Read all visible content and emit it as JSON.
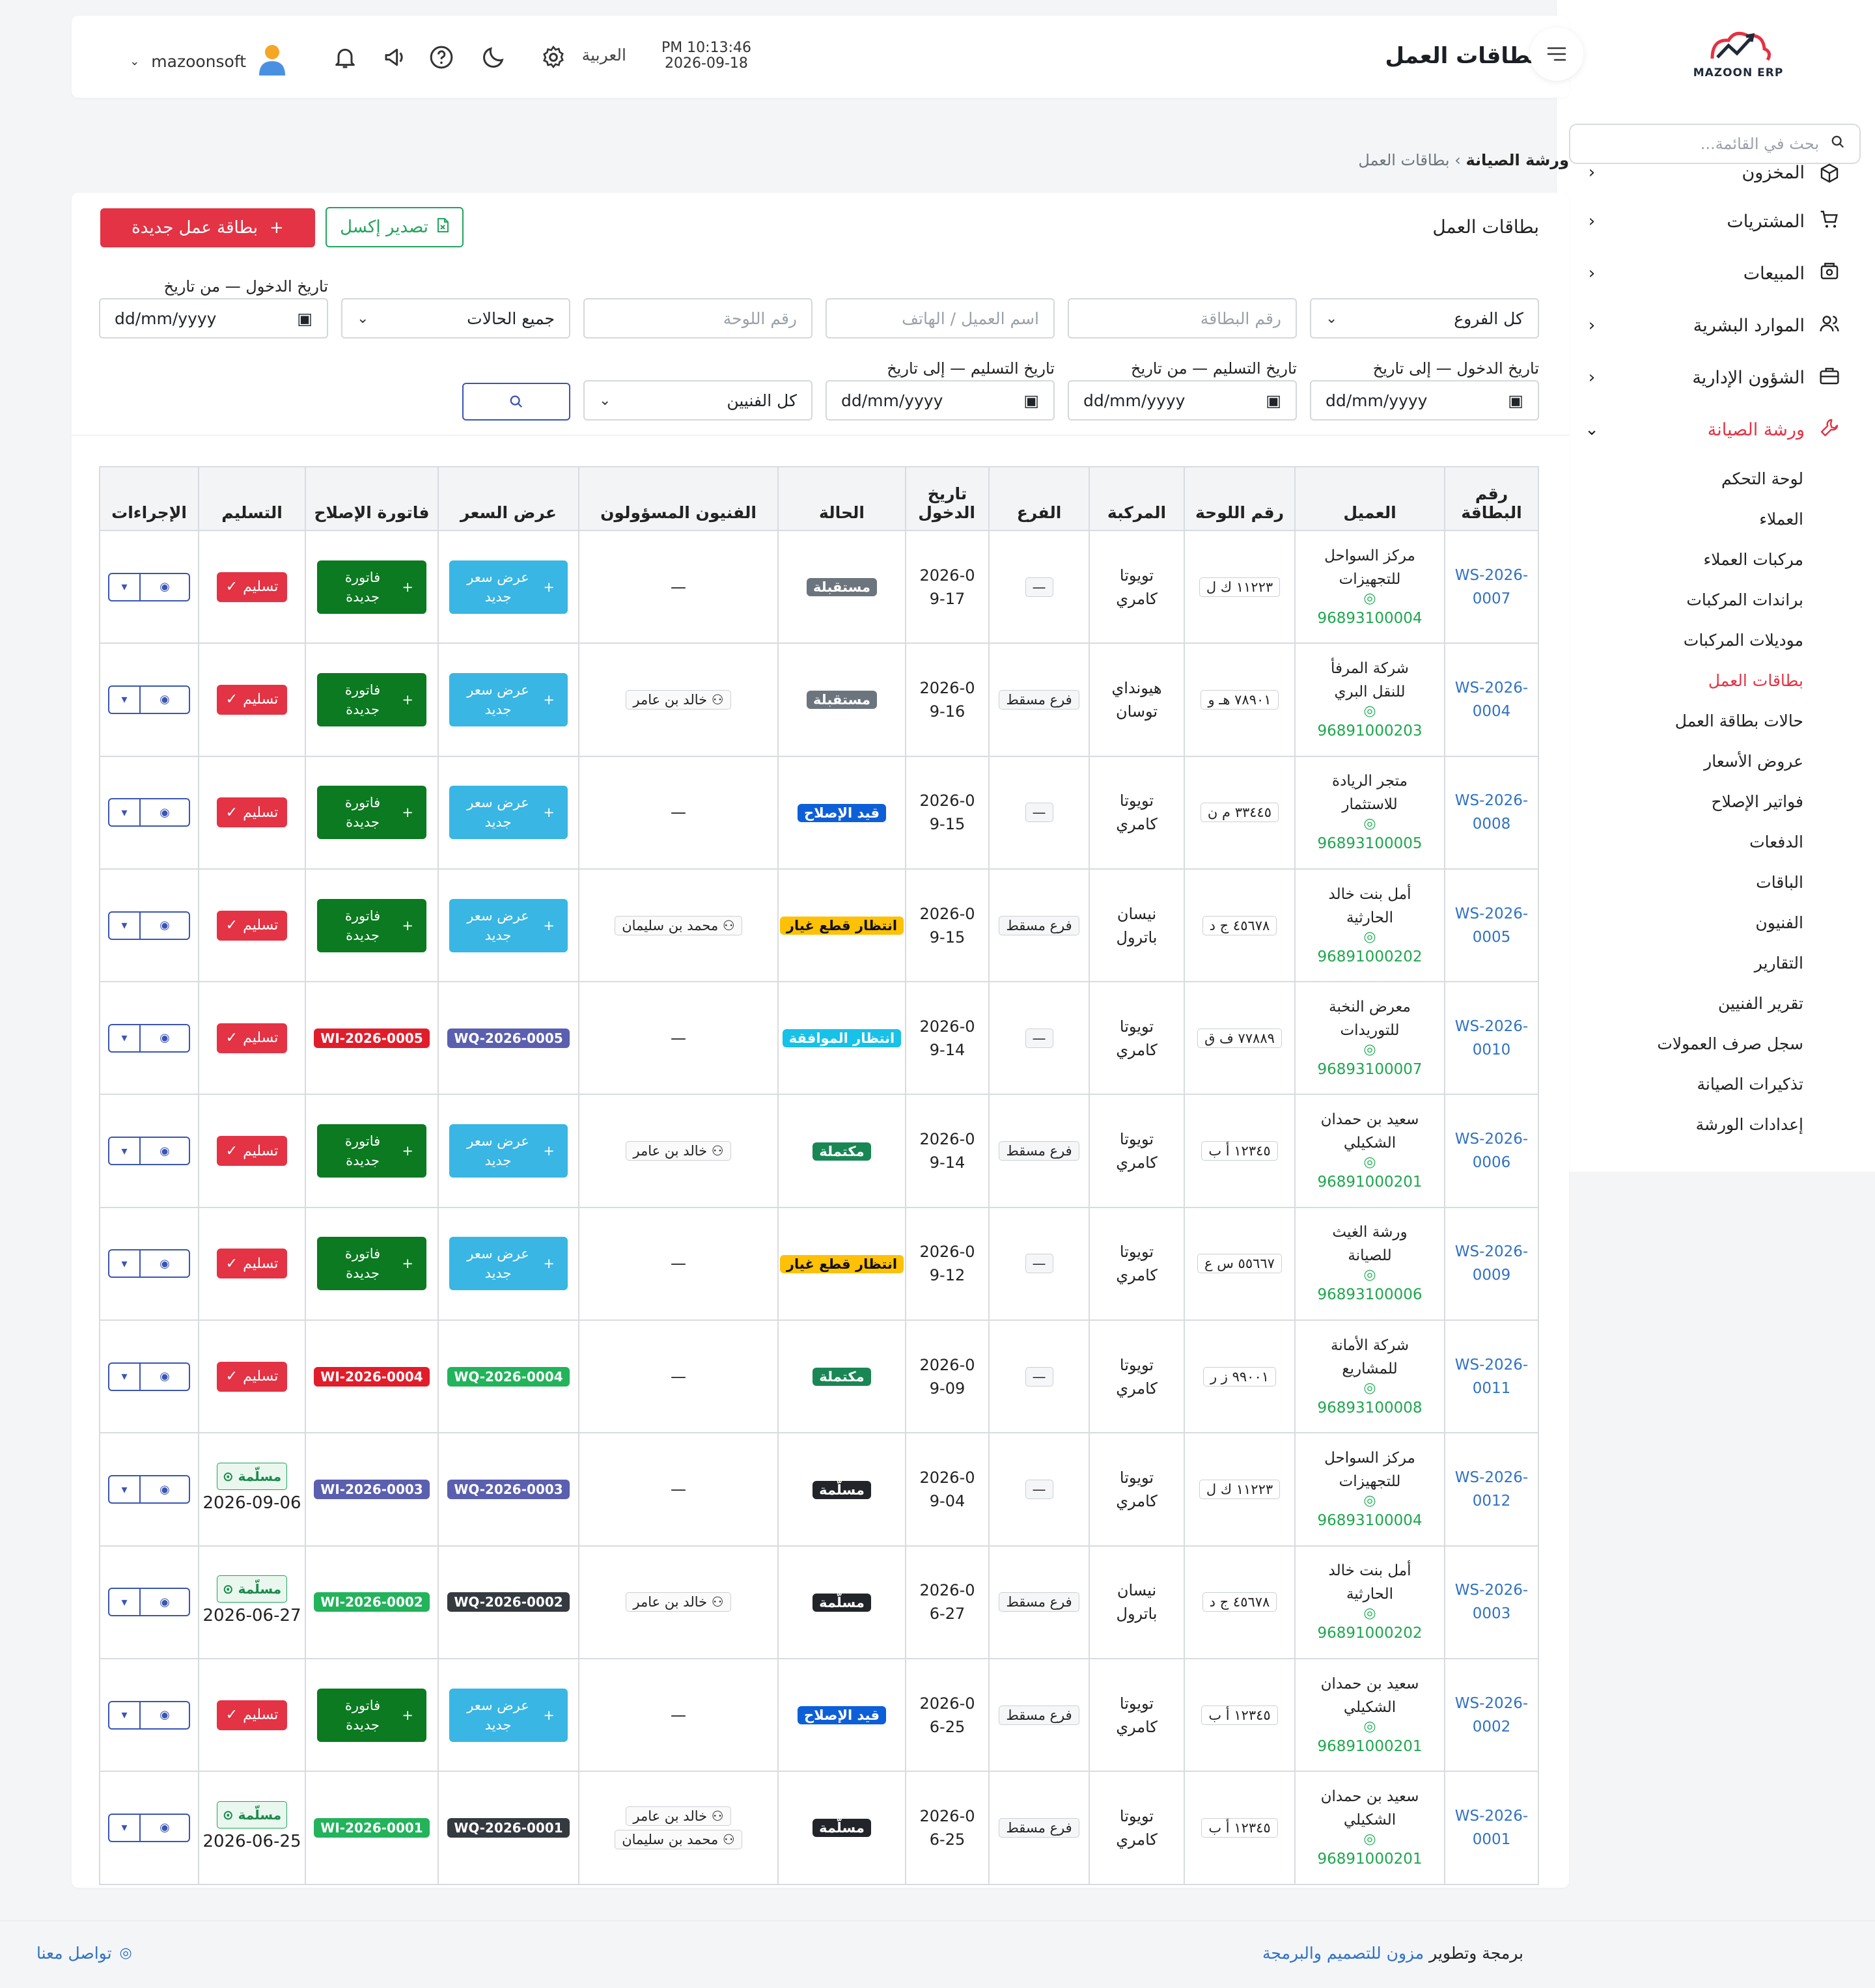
{
  "app": {
    "logo_text": "MAZOON ERP",
    "page_title": "بطاقات العمل"
  },
  "header": {
    "time": "PM 10:13:46",
    "date": "2026-09-18",
    "language": "العربية",
    "username": "mazoonsoft"
  },
  "sidebar": {
    "search_placeholder": "بحث في القائمة...",
    "items": [
      {
        "label": "المخزون",
        "icon": "box-icon"
      },
      {
        "label": "المشتريات",
        "icon": "cart-icon"
      },
      {
        "label": "المبيعات",
        "icon": "register-icon"
      },
      {
        "label": "الموارد البشرية",
        "icon": "users-icon"
      },
      {
        "label": "الشؤون الإدارية",
        "icon": "briefcase-icon"
      },
      {
        "label": "ورشة الصيانة",
        "icon": "wrench-icon"
      }
    ],
    "subitems": [
      "لوحة التحكم",
      "العملاء",
      "مركبات العملاء",
      "براندات المركبات",
      "موديلات المركبات",
      "بطاقات العمل",
      "حالات بطاقة العمل",
      "عروض الأسعار",
      "فواتير الإصلاح",
      "الدفعات",
      "الباقات",
      "الفنيون",
      "التقارير",
      "تقرير الفنيين",
      "سجل صرف العمولات",
      "تذكيرات الصيانة",
      "إعدادات الورشة"
    ]
  },
  "breadcrumb": {
    "root": "ورشة الصيانة",
    "current": "بطاقات العمل"
  },
  "card": {
    "title": "بطاقات العمل",
    "new_button": "بطاقة عمل جديدة",
    "export_button": "تصدير إكسل"
  },
  "filters": {
    "branch": "كل الفروع",
    "card_no_placeholder": "رقم البطاقة",
    "customer_placeholder": "اسم العميل / الهاتف",
    "plate_placeholder": "رقم اللوحة",
    "status": "جميع الحالات",
    "entry_from_label": "تاريخ الدخول — من تاريخ",
    "entry_to_label": "تاريخ الدخول — إلى تاريخ",
    "delivery_from_label": "تاريخ التسليم — من تاريخ",
    "delivery_to_label": "تاريخ التسليم — إلى تاريخ",
    "date_placeholder": "dd/mm/yyyy",
    "technicians": "كل الفنيين"
  },
  "table": {
    "headers": {
      "no": "رقم البطاقة",
      "customer": "العميل",
      "plate": "رقم اللوحة",
      "vehicle": "المركبة",
      "branch": "الفرع",
      "entry": "تاريخ الدخول",
      "status": "الحالة",
      "techs": "الفنيون المسؤولون",
      "quote": "عرض السعر",
      "invoice": "فاتورة الإصلاح",
      "delivery": "التسليم",
      "actions": "الإجراءات"
    },
    "new_quote_label": "عرض سعر جديد",
    "new_invoice_label": "فاتورة جديدة",
    "deliver_label": "تسليم",
    "delivered_label": "مسلّمة",
    "dash": "—",
    "status_colors": {
      "مستقبلة": "#6c757d",
      "قيد الإصلاح": "#0d5fd8",
      "انتظار قطع غيار": "#ffc107",
      "انتظار الموافقة": "#17c1e8",
      "مكتملة": "#198754",
      "مسلّمة": "#212529"
    },
    "rows": [
      {
        "no": "WS-2026-0007",
        "customer": "مركز السواحل للتجهيزات",
        "phone": "96893100004",
        "plate": "١١٢٢٣ ك ل",
        "vehicle": "تويوتا كامري",
        "branch": "",
        "entry": "2026-09-17",
        "status": "مستقبلة",
        "techs": [],
        "quote": "",
        "invoice": "",
        "delivered": ""
      },
      {
        "no": "WS-2026-0004",
        "customer": "شركة المرفأ للنقل البري",
        "phone": "96891000203",
        "plate": "٧٨٩٠١ هـ و",
        "vehicle": "هيونداي توسان",
        "branch": "فرع مسقط",
        "entry": "2026-09-16",
        "status": "مستقبلة",
        "techs": [
          "خالد بن عامر"
        ],
        "quote": "",
        "invoice": "",
        "delivered": ""
      },
      {
        "no": "WS-2026-0008",
        "customer": "متجر الريادة للاستثمار",
        "phone": "96893100005",
        "plate": "٣٣٤٤٥ م ن",
        "vehicle": "تويوتا كامري",
        "branch": "",
        "entry": "2026-09-15",
        "status": "قيد الإصلاح",
        "techs": [],
        "quote": "",
        "invoice": "",
        "delivered": ""
      },
      {
        "no": "WS-2026-0005",
        "customer": "أمل بنت خالد الحارثية",
        "phone": "96891000202",
        "plate": "٤٥٦٧٨ ج د",
        "vehicle": "نيسان باترول",
        "branch": "فرع مسقط",
        "entry": "2026-09-15",
        "status": "انتظار قطع غيار",
        "techs": [
          "محمد بن سليمان"
        ],
        "quote": "",
        "invoice": "",
        "delivered": ""
      },
      {
        "no": "WS-2026-0010",
        "customer": "معرض النخبة للتوريدات",
        "phone": "96893100007",
        "plate": "٧٧٨٨٩ ف ق",
        "vehicle": "تويوتا كامري",
        "branch": "",
        "entry": "2026-09-14",
        "status": "انتظار الموافقة",
        "techs": [],
        "quote": "WQ-2026-0005",
        "quote_color": "#5a5fb0",
        "invoice": "WI-2026-0005",
        "invoice_color": "#e11d2a",
        "delivered": ""
      },
      {
        "no": "WS-2026-0006",
        "customer": "سعيد بن حمدان الشكيلي",
        "phone": "96891000201",
        "plate": "١٢٣٤٥ أ ب",
        "vehicle": "تويوتا كامري",
        "branch": "فرع مسقط",
        "entry": "2026-09-14",
        "status": "مكتملة",
        "techs": [
          "خالد بن عامر"
        ],
        "quote": "",
        "invoice": "",
        "delivered": ""
      },
      {
        "no": "WS-2026-0009",
        "customer": "ورشة الغيث للصيانة",
        "phone": "96893100006",
        "plate": "٥٥٦٦٧ س ع",
        "vehicle": "تويوتا كامري",
        "branch": "",
        "entry": "2026-09-12",
        "status": "انتظار قطع غيار",
        "techs": [],
        "quote": "",
        "invoice": "",
        "delivered": ""
      },
      {
        "no": "WS-2026-0011",
        "customer": "شركة الأمانة للمشاريع",
        "phone": "96893100008",
        "plate": "٩٩٠٠١ ز ر",
        "vehicle": "تويوتا كامري",
        "branch": "",
        "entry": "2026-09-09",
        "status": "مكتملة",
        "techs": [],
        "quote": "WQ-2026-0004",
        "quote_color": "#22b35b",
        "invoice": "WI-2026-0004",
        "invoice_color": "#e11d2a",
        "delivered": ""
      },
      {
        "no": "WS-2026-0012",
        "customer": "مركز السواحل للتجهيزات",
        "phone": "96893100004",
        "plate": "١١٢٢٣ ك ل",
        "vehicle": "تويوتا كامري",
        "branch": "",
        "entry": "2026-09-04",
        "status": "مسلّمة",
        "techs": [],
        "quote": "WQ-2026-0003",
        "quote_color": "#5a5fb0",
        "invoice": "WI-2026-0003",
        "invoice_color": "#5a5fb0",
        "delivered": "2026-09-06"
      },
      {
        "no": "WS-2026-0003",
        "customer": "أمل بنت خالد الحارثية",
        "phone": "96891000202",
        "plate": "٤٥٦٧٨ ج د",
        "vehicle": "نيسان باترول",
        "branch": "فرع مسقط",
        "entry": "2026-06-27",
        "status": "مسلّمة",
        "techs": [
          "خالد بن عامر"
        ],
        "quote": "WQ-2026-0002",
        "quote_color": "#343a40",
        "invoice": "WI-2026-0002",
        "invoice_color": "#22b35b",
        "delivered": "2026-06-27"
      },
      {
        "no": "WS-2026-0002",
        "customer": "سعيد بن حمدان الشكيلي",
        "phone": "96891000201",
        "plate": "١٢٣٤٥ أ ب",
        "vehicle": "تويوتا كامري",
        "branch": "فرع مسقط",
        "entry": "2026-06-25",
        "status": "قيد الإصلاح",
        "techs": [],
        "quote": "",
        "invoice": "",
        "delivered": ""
      },
      {
        "no": "WS-2026-0001",
        "customer": "سعيد بن حمدان الشكيلي",
        "phone": "96891000201",
        "plate": "١٢٣٤٥ أ ب",
        "vehicle": "تويوتا كامري",
        "branch": "فرع مسقط",
        "entry": "2026-06-25",
        "status": "مسلّمة",
        "techs": [
          "خالد بن عامر",
          "محمد بن سليمان"
        ],
        "quote": "WQ-2026-0001",
        "quote_color": "#343a40",
        "invoice": "WI-2026-0001",
        "invoice_color": "#22b35b",
        "delivered": "2026-06-25"
      }
    ]
  },
  "footer": {
    "credit_prefix": "برمجة وتطوير",
    "credit_link": "مزون للتصميم والبرمجة",
    "contact": "تواصل معنا"
  }
}
